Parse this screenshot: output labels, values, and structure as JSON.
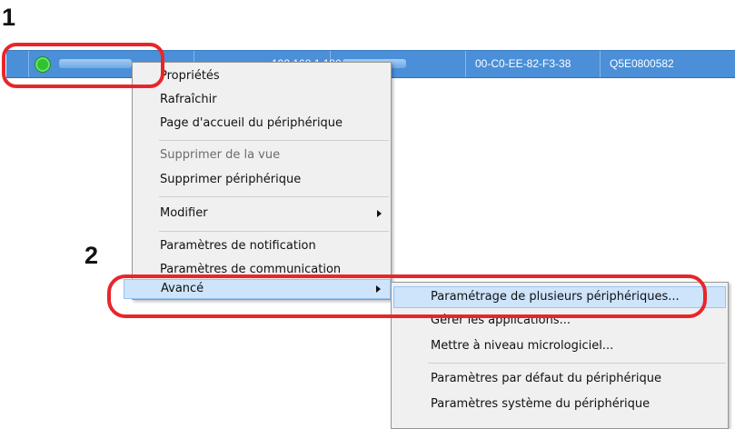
{
  "step_labels": {
    "first": "1",
    "second": "2"
  },
  "device_row": {
    "ip_address": "192.168.1.180",
    "mac_address": "00-C0-EE-82-F3-38",
    "serial_number": "Q5E0800582",
    "status_color": "#2ec42e",
    "selection_color": "#4a8fd8"
  },
  "context_menu": {
    "items": [
      {
        "label": "Propriétés"
      },
      {
        "label": "Rafraîchir"
      },
      {
        "label": "Page d'accueil du périphérique"
      },
      {
        "label": "Supprimer de la vue",
        "disabled": true
      },
      {
        "label": "Supprimer périphérique"
      },
      {
        "label": "Modifier",
        "submenu": true
      },
      {
        "label": "Paramètres de notification"
      },
      {
        "label": "Paramètres de communication"
      },
      {
        "label": "Avancé",
        "submenu": true,
        "highlighted": true
      }
    ]
  },
  "advanced_submenu": {
    "items": [
      {
        "label": "Paramétrage de plusieurs périphériques...",
        "highlighted": true
      },
      {
        "label": "Gérer les applications..."
      },
      {
        "label": "Mettre à niveau micrologiciel..."
      },
      {
        "label": "Paramètres par défaut du périphérique"
      },
      {
        "label": "Paramètres système du périphérique"
      }
    ]
  },
  "annotation_color": "#e8262a"
}
